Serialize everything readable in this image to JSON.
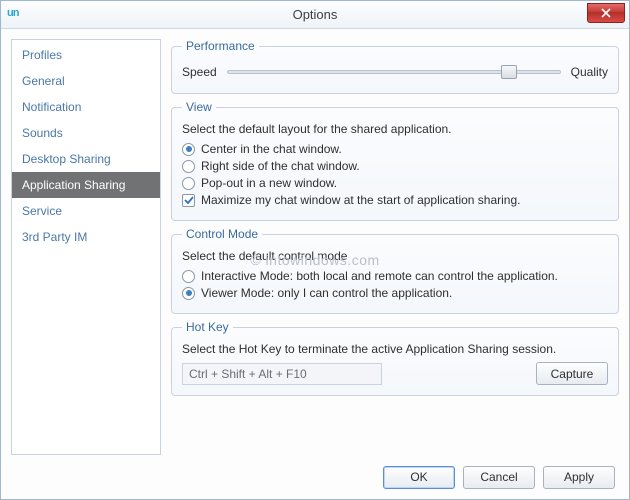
{
  "window": {
    "title": "Options",
    "app_logo_text": "un"
  },
  "sidebar": {
    "items": [
      {
        "label": "Profiles"
      },
      {
        "label": "General"
      },
      {
        "label": "Notification"
      },
      {
        "label": "Sounds"
      },
      {
        "label": "Desktop Sharing"
      },
      {
        "label": "Application  Sharing"
      },
      {
        "label": "Service"
      },
      {
        "label": "3rd Party IM"
      }
    ],
    "selected_index": 5
  },
  "performance": {
    "legend": "Performance",
    "left_label": "Speed",
    "right_label": "Quality",
    "value": 82
  },
  "view": {
    "legend": "View",
    "desc": "Select the default layout for the shared application.",
    "options": [
      {
        "label": "Center in the chat window.",
        "checked": true
      },
      {
        "label": "Right side of the chat window.",
        "checked": false
      },
      {
        "label": "Pop-out in a new window.",
        "checked": false
      }
    ],
    "maximize": {
      "label": "Maximize my chat window at the start of application sharing.",
      "checked": true
    }
  },
  "control_mode": {
    "legend": "Control Mode",
    "desc": "Select the default control mode",
    "options": [
      {
        "label": "Interactive Mode: both local and remote can control the application.",
        "checked": false
      },
      {
        "label": "Viewer Mode: only I can control the application.",
        "checked": true
      }
    ]
  },
  "hotkey": {
    "legend": "Hot Key",
    "desc": "Select the Hot Key to terminate the active Application Sharing session.",
    "value": "Ctrl + Shift + Alt + F10",
    "capture_label": "Capture"
  },
  "buttons": {
    "ok": "OK",
    "cancel": "Cancel",
    "apply": "Apply"
  },
  "watermark": "© intowindows.com"
}
